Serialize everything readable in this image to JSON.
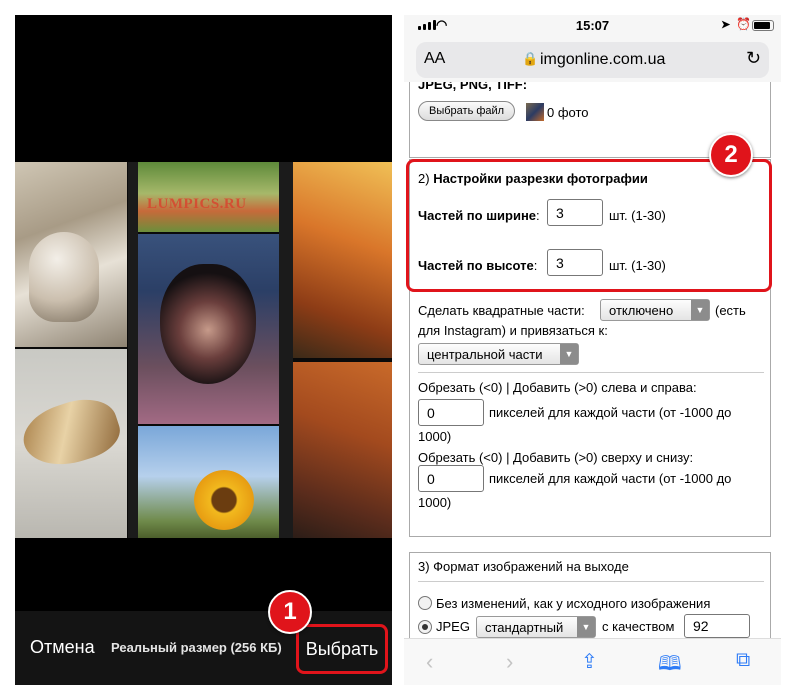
{
  "left": {
    "watermark": "LUMPICS.RU",
    "cancel_label": "Отмена",
    "size_label": "Реальный размер (256 КБ)",
    "choose_label": "Выбрать"
  },
  "status": {
    "time": "15:07"
  },
  "urlbar": {
    "aa_label": "AA",
    "url": "imgonline.com.ua"
  },
  "section1": {
    "formats": "JPEG, PNG, TIFF:",
    "file_button": "Выбрать файл",
    "file_count": "0 фото"
  },
  "section2": {
    "number": "2)",
    "title": "Настройки разрезки фотографии",
    "width_label": "Частей по ширине",
    "width_value": "3",
    "width_range": "шт. (1-30)",
    "height_label": "Частей по высоте",
    "height_value": "3",
    "height_range": "шт. (1-30)",
    "square_label_a": "Сделать квадратные части:",
    "square_value": "отключено",
    "square_label_b": "(есть",
    "square_label_c": "для Instagram) и привязаться к:",
    "anchor_value": "центральной части",
    "lr_label": "Обрезать (<0) | Добавить (>0) слева и справа:",
    "lr_value": "0",
    "lr_hint_a": "пикселей для каждой части (от -1000 до",
    "lr_hint_b": "1000)",
    "tb_label": "Обрезать (<0) | Добавить (>0) сверху и снизу:",
    "tb_value": "0",
    "tb_hint_a": "пикселей для каждой части (от -1000 до",
    "tb_hint_b": "1000)"
  },
  "section3": {
    "title": "3) Формат изображений на выходе",
    "opt_same": "Без изменений, как у исходного изображения",
    "opt_jpeg": "JPEG",
    "jpeg_mode": "стандартный",
    "quality_label": "с качеством",
    "quality_value": "92"
  },
  "callouts": {
    "one": "1",
    "two": "2"
  },
  "colors": {
    "highlight": "#e0141b",
    "accent": "#2f7cf6"
  },
  "toolbar_icons": [
    "back-icon",
    "forward-icon",
    "share-icon",
    "bookmarks-icon",
    "tabs-icon"
  ]
}
